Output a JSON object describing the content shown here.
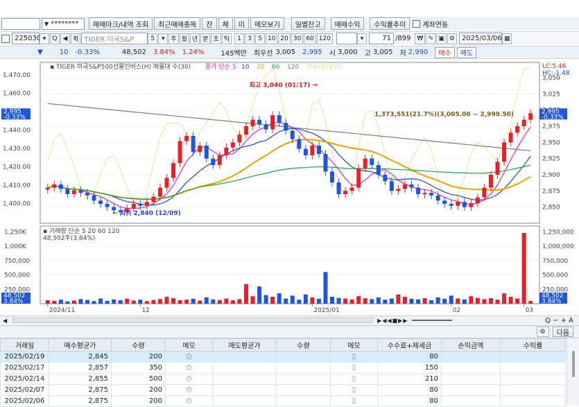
{
  "toolbar1": {
    "masked_code": "********",
    "buttons": [
      "매매마크/내역 조회",
      "최근매매종목",
      "잔",
      "체",
      "미",
      "메모보기",
      "일별잔고",
      "매매수익",
      "수익률추이"
    ],
    "checkbox_label": "계좌연동"
  },
  "toolbar2": {
    "stock_code": "225030",
    "name_field": "TIGER 미국S&P",
    "periods": [
      "주",
      "월",
      "년",
      "분",
      "초",
      "틱"
    ],
    "intervals": [
      "1",
      "3",
      "5",
      "10",
      "20",
      "30",
      "60",
      "120"
    ],
    "count": "71",
    "total": "/899",
    "date": "2025/03/06"
  },
  "quote": {
    "price": "2,995",
    "change": "10",
    "change_pct": "-0.33%",
    "volume": "48,502",
    "vol_ratio": "3.84%",
    "turnover_ratio": "1.24%",
    "amount": "145백만",
    "bid_label": "최우선",
    "ask1": "3,005",
    "bid1": "2,995",
    "open_label": "시",
    "open": "3,000",
    "high_label": "고",
    "high": "3,005",
    "low_label": "저",
    "low": "2,990",
    "buy_button": "매수",
    "sell_button": "매도"
  },
  "chart_data": [
    {
      "type": "candlestick",
      "title": "TIGER 미국S&P500선물인버스(H) 매물대 수(30)",
      "legend": [
        "종가 단순 5",
        "10",
        "20",
        "60",
        "120",
        "환율(원/달러)"
      ],
      "legend_colors": [
        "#e0299b",
        "#2040d0",
        "#e8a000",
        "#1aa04a",
        "#7a7a7a",
        "#e8d890"
      ],
      "left_axis": [
        "1,470.00",
        "1,460.00",
        "1,450.00",
        "1,440.00",
        "1,430.00",
        "1,420.00",
        "1,410.00",
        "1,400.00"
      ],
      "right_axis": [
        "3,050",
        "3,025",
        "3,000",
        "2,975",
        "2,950",
        "2,925",
        "2,900",
        "2,875",
        "2,850"
      ],
      "current_price": "2,995",
      "current_change": "-0.33%",
      "left_current": "2,995",
      "left_change": "-0.33%",
      "ylim": [
        2825,
        3065
      ],
      "high_annotation": "최고 3,040 (01/17)",
      "low_annotation": "최저 2,840 (12/09)",
      "range_annotation": "1,373,551(21.7%)(3,005.00 ~ 2,999.50)",
      "lc_label": "LC:5.46",
      "hc_label": "HC:-1.48",
      "closes": [
        2880,
        2885,
        2878,
        2870,
        2876,
        2872,
        2868,
        2860,
        2855,
        2850,
        2845,
        2842,
        2848,
        2855,
        2852,
        2858,
        2866,
        2880,
        2895,
        2918,
        2952,
        2960,
        2935,
        2945,
        2925,
        2915,
        2930,
        2942,
        2950,
        2962,
        2975,
        2985,
        2978,
        2970,
        2992,
        2980,
        2968,
        2955,
        2940,
        2930,
        2945,
        2932,
        2905,
        2888,
        2870,
        2875,
        2880,
        2910,
        2925,
        2915,
        2900,
        2890,
        2875,
        2878,
        2885,
        2880,
        2870,
        2872,
        2868,
        2860,
        2855,
        2852,
        2858,
        2850,
        2856,
        2865,
        2880,
        2900,
        2920,
        2950,
        2965,
        2975,
        2985,
        2995
      ]
    },
    {
      "type": "bar",
      "title": "거래량 단순 5 20 60 120",
      "legend": [
        "거래량",
        "단순 5",
        "20",
        "60",
        "120"
      ],
      "legend_colors": [
        "#555555",
        "#e0299b",
        "#e8a000",
        "#1aa04a",
        "#7a7a7a"
      ],
      "left_axis": [
        "1,250K",
        "1,000K",
        "750,000",
        "500,000",
        "250,000"
      ],
      "right_axis": [
        "1,250,000",
        "1,000,000",
        "750,000",
        "500,000",
        "250,000"
      ],
      "current_volume": "48,502",
      "current_ratio": "3.84%",
      "volume_label": "48,502주(3.84%)",
      "ylim": [
        0,
        1350000
      ],
      "values": [
        60000,
        50000,
        70000,
        40000,
        55000,
        80000,
        65000,
        45000,
        90000,
        50000,
        75000,
        60000,
        85000,
        55000,
        70000,
        45000,
        65000,
        80000,
        120000,
        95000,
        60000,
        70000,
        85000,
        55000,
        110000,
        75000,
        65000,
        90000,
        60000,
        80000,
        340000,
        130000,
        300000,
        150000,
        120000,
        180000,
        90000,
        140000,
        70000,
        160000,
        110000,
        85000,
        550000,
        120000,
        100000,
        90000,
        75000,
        130000,
        95000,
        80000,
        110000,
        70000,
        90000,
        160000,
        120000,
        85000,
        75000,
        95000,
        60000,
        110000,
        85000,
        140000,
        90000,
        75000,
        130000,
        100000,
        80000,
        95000,
        70000,
        180000,
        120000,
        90000,
        1230000,
        48502
      ],
      "x_labels": [
        "2024/11",
        "12",
        "2025/01",
        "02",
        "03"
      ]
    }
  ],
  "scroll": {
    "right_icons": "Q − + A"
  },
  "grid": {
    "next_button": "다음",
    "columns": [
      "거래일",
      "매수평균가",
      "수량",
      "메모",
      "매도평균가",
      "수량",
      "메모",
      "수수료+제세금",
      "손익금액",
      "수익률"
    ],
    "rows": [
      {
        "date": "2025/02/19",
        "avg": "2,845",
        "qty": "200",
        "fee": "80"
      },
      {
        "date": "2025/02/17",
        "avg": "2,857",
        "qty": "350",
        "fee": "150"
      },
      {
        "date": "2025/02/14",
        "avg": "2,855",
        "qty": "500",
        "fee": "210"
      },
      {
        "date": "2025/02/07",
        "avg": "2,875",
        "qty": "200",
        "fee": "80"
      },
      {
        "date": "2025/02/06",
        "avg": "2,875",
        "qty": "200",
        "fee": "80"
      }
    ]
  }
}
